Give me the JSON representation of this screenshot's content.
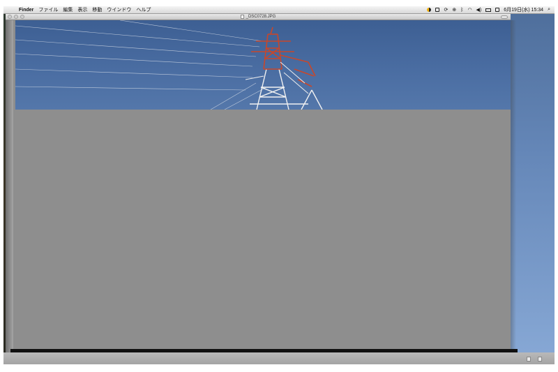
{
  "menubar": {
    "apple_glyph": "",
    "app_name": "Finder",
    "menus": [
      "ファイル",
      "編集",
      "表示",
      "移動",
      "ウインドウ",
      "ヘルプ"
    ],
    "datetime": "6月19日(水) 15:34",
    "spotlight_glyph": "⌕",
    "bluetooth_glyph": "ᛒ",
    "wifi_glyph": "◠",
    "volume_glyph": "◀)",
    "sync_glyph": "⟳",
    "timemachine_glyph": "⊕"
  },
  "window": {
    "title": "_DSC0728.JPG"
  },
  "colors": {
    "sky": "#4b6ea3",
    "tower_red": "#c8472b",
    "placeholder_gray": "#8e8e8e"
  }
}
